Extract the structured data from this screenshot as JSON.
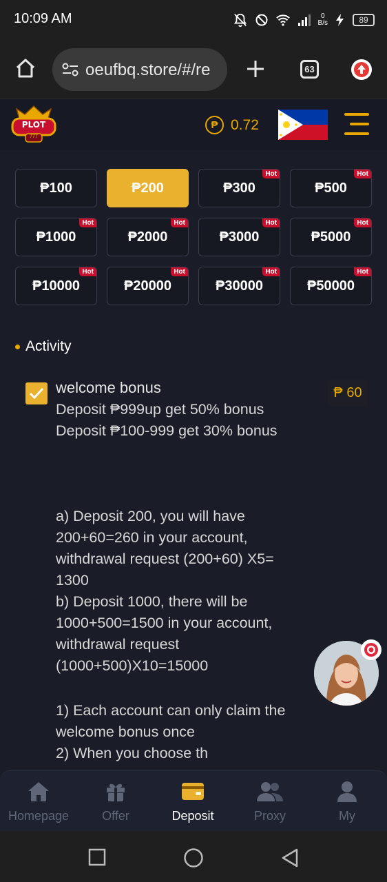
{
  "status_bar": {
    "time": "10:09 AM",
    "net_speed_value": "0",
    "net_speed_unit": "B/s",
    "battery": "89"
  },
  "browser": {
    "url": "oeufbq.store/#/re",
    "tab_count": "63"
  },
  "header": {
    "logo_text": "PLOT",
    "logo_sub": "777",
    "currency_symbol": "₱",
    "balance": "0.72"
  },
  "amounts": [
    {
      "label": "₱100",
      "hot": false,
      "selected": false
    },
    {
      "label": "₱200",
      "hot": false,
      "selected": true
    },
    {
      "label": "₱300",
      "hot": true,
      "selected": false
    },
    {
      "label": "₱500",
      "hot": true,
      "selected": false
    },
    {
      "label": "₱1000",
      "hot": true,
      "selected": false
    },
    {
      "label": "₱2000",
      "hot": true,
      "selected": false
    },
    {
      "label": "₱3000",
      "hot": true,
      "selected": false
    },
    {
      "label": "₱5000",
      "hot": true,
      "selected": false
    },
    {
      "label": "₱10000",
      "hot": true,
      "selected": false
    },
    {
      "label": "₱20000",
      "hot": true,
      "selected": false
    },
    {
      "label": "₱30000",
      "hot": true,
      "selected": false
    },
    {
      "label": "₱50000",
      "hot": true,
      "selected": false
    }
  ],
  "hot_label": "Hot",
  "activity": {
    "section_title": "Activity",
    "bonus_title": "welcome bonus",
    "bonus_amount": "₱ 60",
    "desc_part1": "Deposit ₱999up get 50% bonus\nDeposit ₱100-999 get 30% bonus",
    "desc_part2": "a) Deposit 200, you will have 200+60=260 in your account, withdrawal request (200+60) X5= 1300\nb) Deposit 1000, there will be 1000+500=1500 in your account, withdrawal request (1000+500)X10=15000",
    "desc_part3": "1) Each account can only claim the welcome bonus once\n2) When you choose th"
  },
  "nav": [
    {
      "label": "Homepage",
      "icon": "home-icon",
      "active": false
    },
    {
      "label": "Offer",
      "icon": "gift-icon",
      "active": false
    },
    {
      "label": "Deposit",
      "icon": "wallet-icon",
      "active": true
    },
    {
      "label": "Proxy",
      "icon": "users-icon",
      "active": false
    },
    {
      "label": "My",
      "icon": "user-icon",
      "active": false
    }
  ],
  "colors": {
    "accent": "#e9b12e",
    "hot": "#c8102e",
    "background": "#1a1d28"
  }
}
